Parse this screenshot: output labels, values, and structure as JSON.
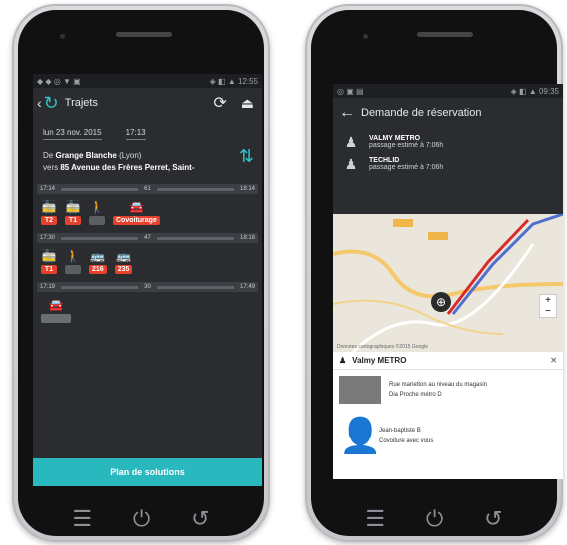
{
  "left_phone": {
    "status_time": "12:55",
    "app_title": "Trajets",
    "date": "lun 23 nov. 2015",
    "time": "17:13",
    "route": {
      "from_label": "De",
      "from_value": "Grange Blanche",
      "from_extra": "(Lyon)",
      "to_label": "vers",
      "to_value": "85 Avenue des Frères Perret, Saint-"
    },
    "trips": [
      {
        "depart": "17:14",
        "duration": "61",
        "arrive": "18:14",
        "legs": [
          {
            "icon": "tram-icon",
            "badge": "T2",
            "style": "red"
          },
          {
            "icon": "tram-icon",
            "badge": "T1",
            "style": "red"
          },
          {
            "icon": "walk-icon",
            "badge": "",
            "style": "walk"
          },
          {
            "icon": "car-icon",
            "badge": "Covoiturage",
            "style": "red"
          }
        ]
      },
      {
        "depart": "17:30",
        "duration": "47",
        "arrive": "18:18",
        "legs": [
          {
            "icon": "tram-icon",
            "badge": "T1",
            "style": "red"
          },
          {
            "icon": "walk-icon",
            "badge": "",
            "style": "walk"
          },
          {
            "icon": "bus-icon",
            "badge": "216",
            "style": "red"
          },
          {
            "icon": "bus-icon",
            "badge": "235",
            "style": "red"
          }
        ]
      },
      {
        "depart": "17:19",
        "duration": "30",
        "arrive": "17:49",
        "legs": [
          {
            "icon": "car-icon",
            "badge": "",
            "style": "grey"
          }
        ]
      }
    ],
    "plan_button": "Plan de solutions"
  },
  "right_phone": {
    "status_time": "09:35",
    "title": "Demande de réservation",
    "rides": [
      {
        "name": "VALMY METRO",
        "sub": "passage estimé à 7:06h"
      },
      {
        "name": "TECHLID",
        "sub": "passage estimé à 7:06h"
      }
    ],
    "map_footer": "Données cartographiques ©2015 Google",
    "card_title": "Valmy METRO",
    "card_lines": [
      "Rue marietton au niveau du magasin",
      "Dia Proche métro D"
    ],
    "driver_name": "Jean-baptiste B",
    "driver_note": "Covoiture avec vous"
  },
  "colors": {
    "accent": "#2ab8bf",
    "transit_red": "#e5412d",
    "route_line": "#d92b2b",
    "route_blue": "#4f6fd0"
  }
}
